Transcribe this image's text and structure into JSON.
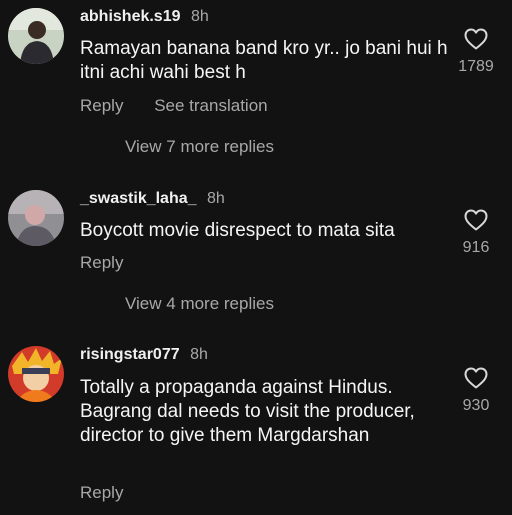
{
  "comments": [
    {
      "username": "abhishek.s19",
      "time": "8h",
      "text": "Ramayan banana band kro yr.. jo bani hui h itni achi wahi best h",
      "reply_label": "Reply",
      "translate_label": "See translation",
      "likes": "1789",
      "view_replies": "View 7 more replies"
    },
    {
      "username": "_swastik_laha_",
      "time": "8h",
      "text": "Boycott movie disrespect to mata sita",
      "reply_label": "Reply",
      "likes": "916",
      "view_replies": "View 4 more replies"
    },
    {
      "username": "risingstar077",
      "time": "8h",
      "text": "Totally a propaganda against Hindus. Bagrang dal needs to visit the producer, director to give them Margdarshan",
      "reply_label": "Reply",
      "likes": "930"
    }
  ],
  "icons": {
    "like": "heart-outline-icon"
  },
  "colors": {
    "background": "#121212",
    "primary_text": "#f5f5f5",
    "secondary_text": "#a8a8a8"
  }
}
